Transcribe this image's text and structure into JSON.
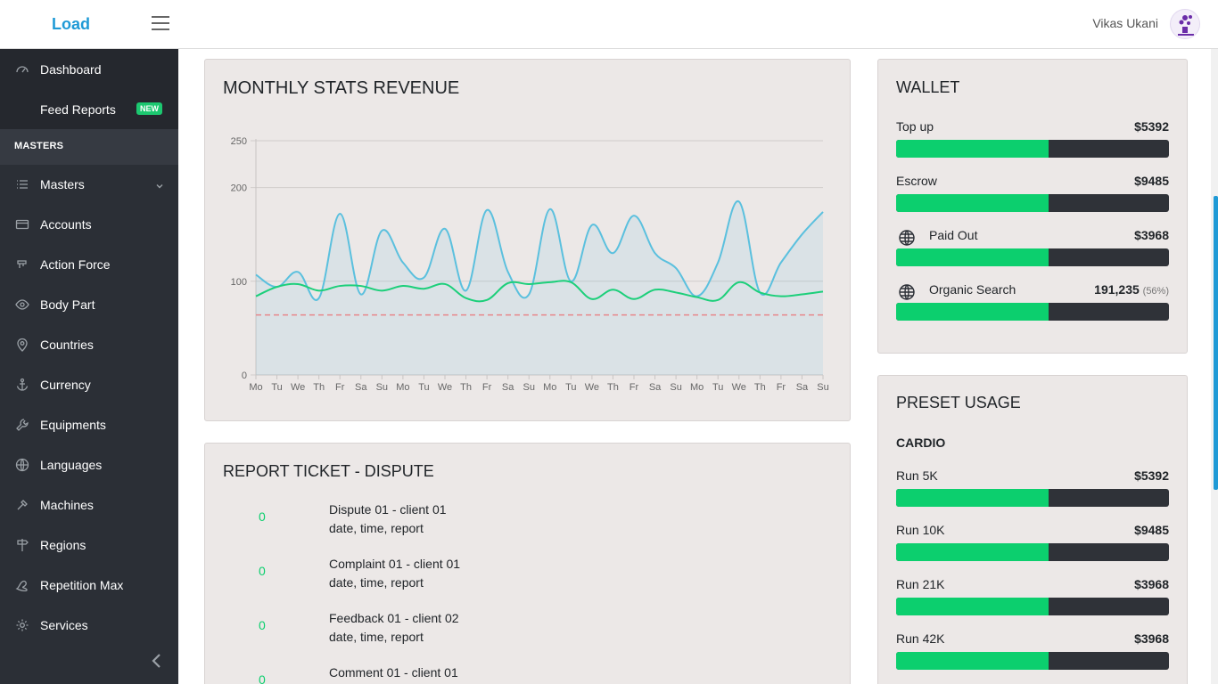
{
  "topbar": {
    "brand": "Load",
    "username": "Vikas Ukani"
  },
  "sidebar": {
    "items_top": [
      {
        "label": "Dashboard",
        "icon": "gauge-icon"
      },
      {
        "label": "Feed Reports",
        "icon": "",
        "badge": "NEW"
      }
    ],
    "section_header": "MASTERS",
    "items": [
      {
        "label": "Masters",
        "icon": "list-icon"
      },
      {
        "label": "Accounts",
        "icon": "credit-card-icon"
      },
      {
        "label": "Action Force",
        "icon": "dumbbell-icon"
      },
      {
        "label": "Body Part",
        "icon": "eye-icon"
      },
      {
        "label": "Countries",
        "icon": "map-pin-icon"
      },
      {
        "label": "Currency",
        "icon": "anchor-icon"
      },
      {
        "label": "Equipments",
        "icon": "wrench-icon"
      },
      {
        "label": "Languages",
        "icon": "globe-icon"
      },
      {
        "label": "Machines",
        "icon": "tool-icon"
      },
      {
        "label": "Regions",
        "icon": "signpost-icon"
      },
      {
        "label": "Repetition Max",
        "icon": "muscle-icon"
      },
      {
        "label": "Services",
        "icon": "gear-icon"
      }
    ]
  },
  "revenue_card": {
    "title": "MONTHLY STATS REVENUE"
  },
  "chart_data": {
    "type": "line",
    "title": "MONTHLY STATS REVENUE",
    "categories": [
      "Mo",
      "Tu",
      "We",
      "Th",
      "Fr",
      "Sa",
      "Su",
      "Mo",
      "Tu",
      "We",
      "Th",
      "Fr",
      "Sa",
      "Su",
      "Mo",
      "Tu",
      "We",
      "Th",
      "Fr",
      "Sa",
      "Su",
      "Mo",
      "Tu",
      "We",
      "Th",
      "Fr",
      "Sa",
      "Su"
    ],
    "y_ticks": [
      0,
      100,
      200,
      250
    ],
    "ylim": [
      0,
      250
    ],
    "grid": true,
    "series": [
      {
        "color": "#5bc0de",
        "fill": true,
        "values": [
          107,
          94,
          110,
          82,
          172,
          86,
          154,
          120,
          104,
          156,
          90,
          176,
          110,
          86,
          177,
          100,
          160,
          130,
          170,
          130,
          114,
          84,
          120,
          185,
          88,
          120,
          150,
          174
        ]
      },
      {
        "color": "#1ccf7a",
        "fill": false,
        "values": [
          84,
          94,
          97,
          90,
          95,
          95,
          90,
          95,
          92,
          97,
          82,
          80,
          98,
          97,
          99,
          99,
          81,
          91,
          81,
          91,
          88,
          83,
          80,
          99,
          88,
          84,
          86,
          89
        ]
      },
      {
        "color": "#e8868a",
        "dashed": true,
        "values": [
          64,
          64,
          64,
          64,
          64,
          64,
          64,
          64,
          64,
          64,
          64,
          64,
          64,
          64,
          64,
          64,
          64,
          64,
          64,
          64,
          64,
          64,
          64,
          64,
          64,
          64,
          64,
          64
        ]
      }
    ]
  },
  "ticket_card": {
    "title": "REPORT TICKET - DISPUTE",
    "rows": [
      {
        "count": "0",
        "title": "Dispute 01 - client 01",
        "sub": "date, time, report"
      },
      {
        "count": "0",
        "title": "Complaint 01 - client 01",
        "sub": "date, time, report"
      },
      {
        "count": "0",
        "title": "Feedback 01 - client 02",
        "sub": "date, time, report"
      },
      {
        "count": "0",
        "title": "Comment 01 - client 01",
        "sub": ""
      }
    ]
  },
  "wallet_card": {
    "title": "WALLET",
    "rows": [
      {
        "label": "Top up",
        "value": "$5392",
        "extra": "",
        "icon": "",
        "fill": 0.56
      },
      {
        "label": "Escrow",
        "value": "$9485",
        "extra": "",
        "icon": "",
        "fill": 0.56
      },
      {
        "label": "Paid Out",
        "value": "$3968",
        "extra": "",
        "icon": "globe-icon",
        "fill": 0.56
      },
      {
        "label": "Organic Search",
        "value": "191,235",
        "extra": "(56%)",
        "icon": "globe-icon",
        "fill": 0.56
      }
    ]
  },
  "preset_card": {
    "title": "PRESET USAGE",
    "subtitle": "CARDIO",
    "rows": [
      {
        "label": "Run 5K",
        "value": "$5392",
        "fill": 0.56
      },
      {
        "label": "Run 10K",
        "value": "$9485",
        "fill": 0.56
      },
      {
        "label": "Run 21K",
        "value": "$3968",
        "fill": 0.56
      },
      {
        "label": "Run 42K",
        "value": "$3968",
        "fill": 0.56
      }
    ]
  },
  "colors": {
    "accent": "#1f9ad6",
    "success": "#0ccf6e",
    "sidebar": "#2b2f36",
    "card": "#ece8e7"
  }
}
